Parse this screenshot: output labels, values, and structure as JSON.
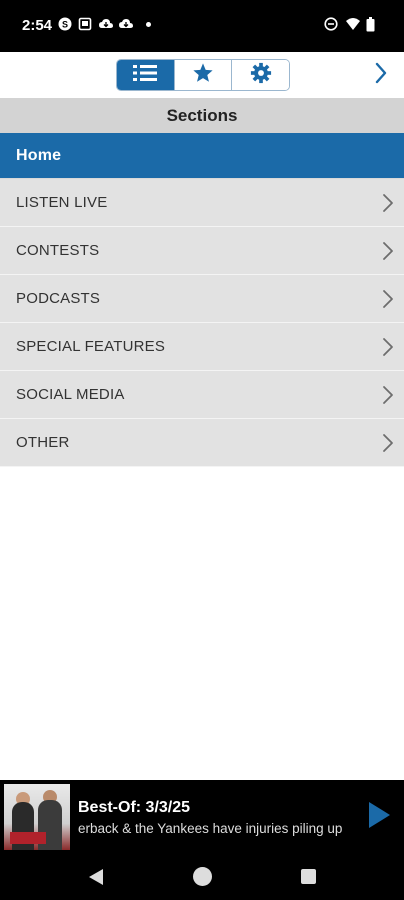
{
  "status_bar": {
    "time": "2:54",
    "left_icons": [
      "skype-icon",
      "tablet-icon",
      "cloud-download-icon",
      "cloud-download-icon"
    ],
    "right_icons": [
      "do-not-disturb-icon",
      "wifi-icon",
      "battery-icon"
    ]
  },
  "toolbar": {
    "segments": [
      {
        "icon": "list-icon",
        "active": true
      },
      {
        "icon": "star-icon",
        "active": false
      },
      {
        "icon": "gear-icon",
        "active": false
      }
    ],
    "next_icon": "chevron-right-icon"
  },
  "sections": {
    "header": "Sections",
    "items": [
      {
        "label": "Home",
        "selected": true
      },
      {
        "label": "LISTEN LIVE"
      },
      {
        "label": "CONTESTS"
      },
      {
        "label": "PODCASTS"
      },
      {
        "label": "SPECIAL FEATURES"
      },
      {
        "label": "SOCIAL MEDIA"
      },
      {
        "label": "OTHER"
      }
    ]
  },
  "player": {
    "title": "Best-Of: 3/3/25",
    "subtitle": "erback & the Yankees have injuries piling up",
    "play_icon": "play-icon"
  },
  "navbar": {
    "back_icon": "back-triangle-icon",
    "home_icon": "home-circle-icon",
    "recents_icon": "recents-square-icon"
  },
  "colors": {
    "accent": "#1b6aa8",
    "row_bg": "#e2e2e2",
    "header_bg": "#d3d3d3"
  }
}
